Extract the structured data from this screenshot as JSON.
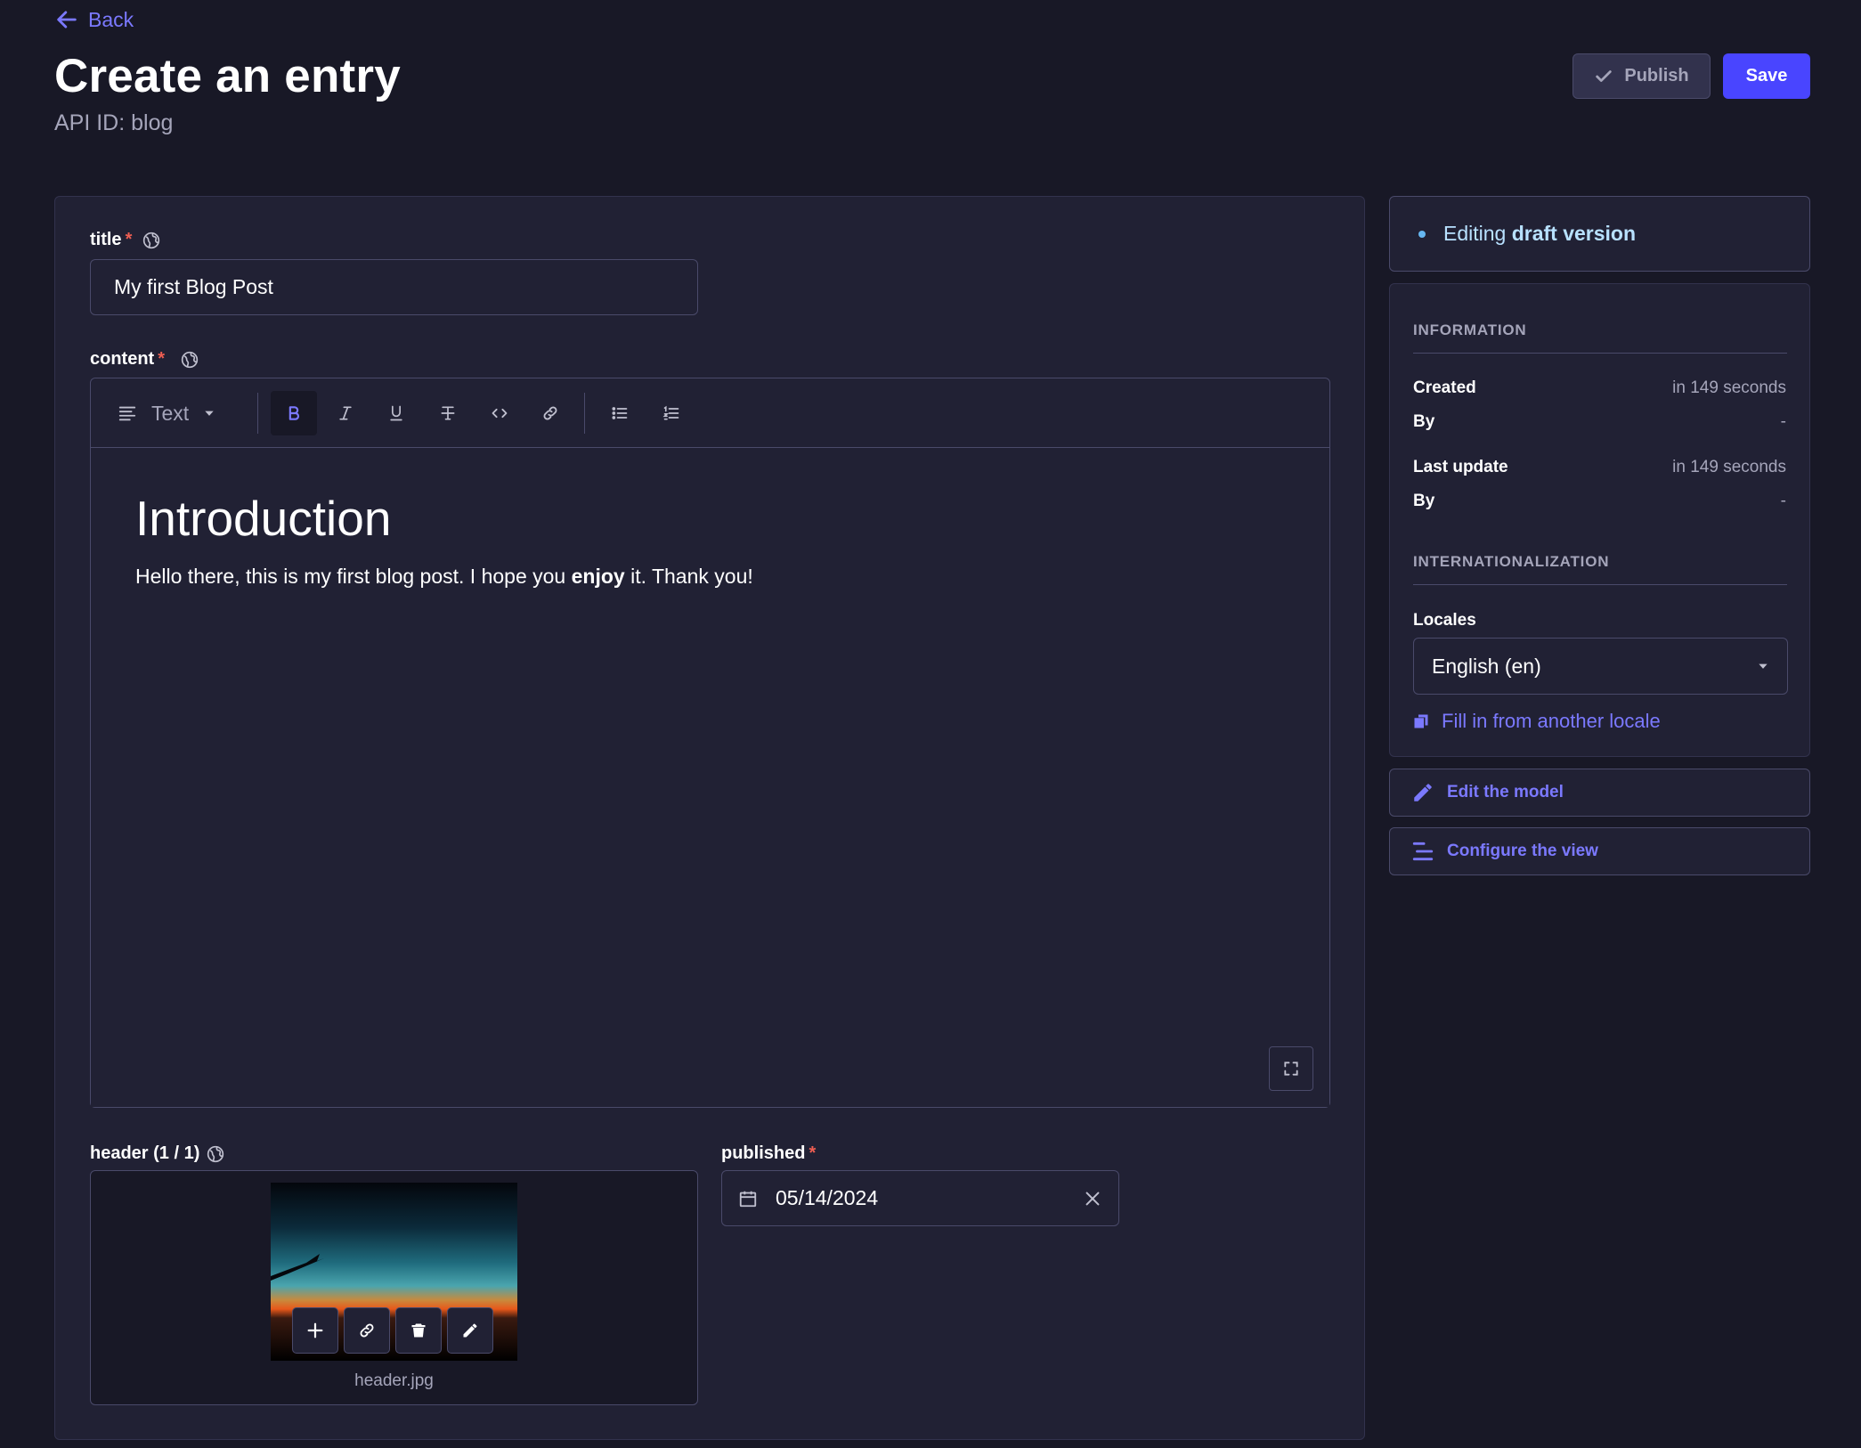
{
  "nav": {
    "back_label": "Back"
  },
  "header": {
    "title": "Create an entry",
    "api_id": "API ID: blog",
    "publish_label": "Publish",
    "save_label": "Save"
  },
  "fields": {
    "title": {
      "label": "title",
      "required_mark": "*",
      "value": "My first Blog Post"
    },
    "content": {
      "label": "content",
      "required_mark": "*",
      "style_select": "Text",
      "heading": "Introduction",
      "paragraph_before": "Hello there, this is my first blog post. I hope you ",
      "paragraph_bold": "enjoy",
      "paragraph_after": " it. Thank you!"
    },
    "header": {
      "label": "header (1 / 1)",
      "file_name": "header.jpg"
    },
    "published": {
      "label": "published",
      "required_mark": "*",
      "value": "05/14/2024"
    }
  },
  "sidebar": {
    "status_prefix": "Editing",
    "status_bold": "draft version",
    "information": {
      "section_title": "INFORMATION",
      "created_label": "Created",
      "created_value": "in 149 seconds",
      "created_by_label": "By",
      "created_by_value": "-",
      "updated_label": "Last update",
      "updated_value": "in 149 seconds",
      "updated_by_label": "By",
      "updated_by_value": "-"
    },
    "i18n": {
      "section_title": "INTERNATIONALIZATION",
      "locales_label": "Locales",
      "locale_value": "English (en)",
      "fill_link": "Fill in from another locale"
    },
    "edit_model_label": "Edit the model",
    "configure_view_label": "Configure the view"
  },
  "colors": {
    "background": "#181826",
    "card": "#212134",
    "primary": "#4945ff",
    "link": "#7b79ff",
    "required": "#ee5e52"
  }
}
